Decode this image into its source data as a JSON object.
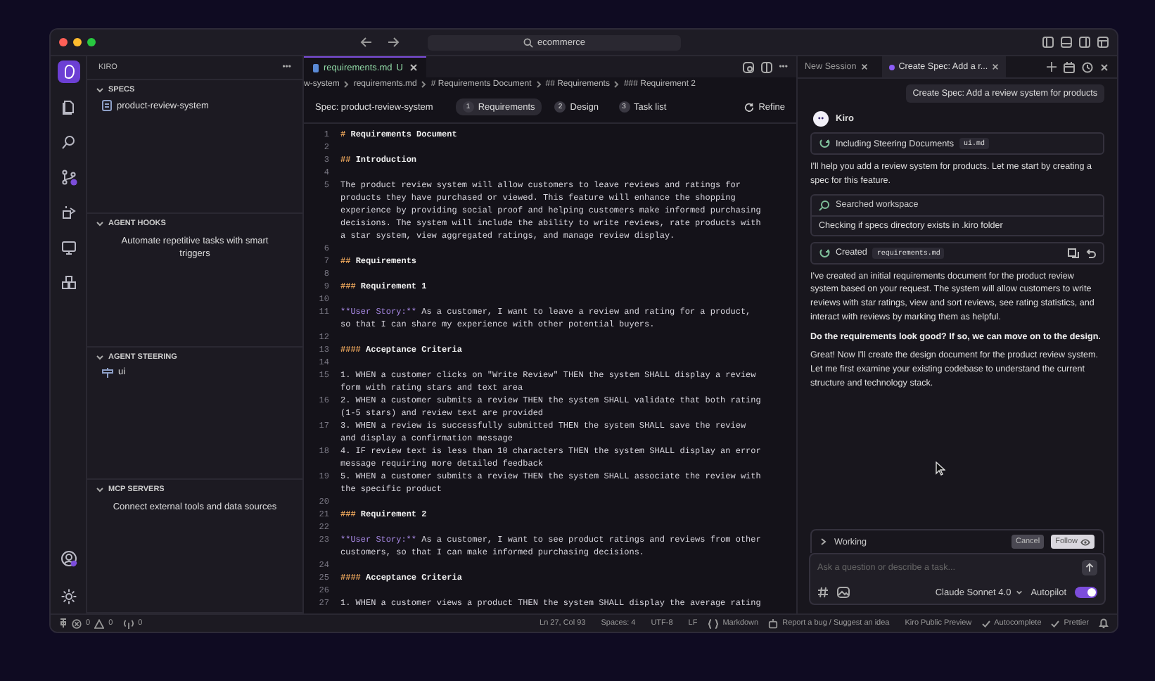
{
  "title_bar": {
    "search": "ecommerce"
  },
  "activity_bar": [
    {
      "selected": true
    },
    {
      "selected": false
    },
    {
      "selected": false
    },
    {
      "selected": false
    },
    {
      "selected": false
    },
    {
      "selected": false
    },
    {
      "selected": false
    }
  ],
  "sidebar": {
    "title": "KIRO",
    "more": "•••",
    "sections": [
      {
        "title": "SPECS",
        "expanded": true,
        "items": [
          "product-review-system"
        ]
      },
      {
        "title": "AGENT HOOKS",
        "expanded": true,
        "message": "Automate repetitive tasks with smart triggers"
      },
      {
        "title": "AGENT STEERING",
        "expanded": true,
        "items": [
          "ui"
        ]
      },
      {
        "title": "MCP SERVERS",
        "expanded": true,
        "message": "Connect external tools and data sources"
      }
    ]
  },
  "editor": {
    "more": "•••",
    "tabs": [
      {
        "label": "requirements.md",
        "status": "U",
        "selected": true
      }
    ],
    "breadcrumb": [
      "w-system",
      "requirements.md",
      "# Requirements Document",
      "## Requirements",
      "### Requirement 2"
    ],
    "spec": {
      "label": "Spec: product-review-system",
      "steps": [
        {
          "number": "1",
          "label": "Requirements",
          "selected": true
        },
        {
          "number": "2",
          "label": "Design",
          "selected": false
        },
        {
          "number": "3",
          "label": "Task list",
          "selected": false
        }
      ],
      "refine": "Refine"
    },
    "lines": [
      {
        "n": "1",
        "kind": "heading",
        "marker": "#",
        "rows": [
          "Requirements Document"
        ]
      },
      {
        "n": "2",
        "kind": "blank"
      },
      {
        "n": "3",
        "kind": "heading",
        "marker": "##",
        "rows": [
          "Introduction"
        ]
      },
      {
        "n": "4",
        "kind": "blank"
      },
      {
        "n": "5",
        "kind": "text",
        "rows": [
          "The product review system will allow customers to leave reviews and ratings for",
          "products they have purchased or viewed. This feature will enhance the shopping",
          "experience by providing social proof and helping customers make informed purchasing",
          "decisions. The system will include the ability to write reviews, rate products with",
          "a star system, view aggregated ratings, and manage review display."
        ]
      },
      {
        "n": "6",
        "kind": "blank"
      },
      {
        "n": "7",
        "kind": "heading",
        "marker": "##",
        "rows": [
          "Requirements"
        ]
      },
      {
        "n": "8",
        "kind": "blank"
      },
      {
        "n": "9",
        "kind": "heading",
        "marker": "###",
        "rows": [
          "Requirement 1"
        ]
      },
      {
        "n": "10",
        "kind": "blank"
      },
      {
        "n": "11",
        "kind": "story",
        "marker": "**User Story:**",
        "rows": [
          "As a customer, I want to leave a review and rating for a product,",
          "so that I can share my experience with other potential buyers."
        ]
      },
      {
        "n": "12",
        "kind": "blank"
      },
      {
        "n": "13",
        "kind": "heading",
        "marker": "####",
        "rows": [
          "Acceptance Criteria"
        ]
      },
      {
        "n": "14",
        "kind": "blank"
      },
      {
        "n": "15",
        "kind": "text",
        "rows": [
          "1. WHEN a customer clicks on \"Write Review\" THEN the system SHALL display a review",
          "form with rating stars and text area"
        ]
      },
      {
        "n": "16",
        "kind": "text",
        "rows": [
          "2. WHEN a customer submits a review THEN the system SHALL validate that both rating",
          "(1-5 stars) and review text are provided"
        ]
      },
      {
        "n": "17",
        "kind": "text",
        "rows": [
          "3. WHEN a review is successfully submitted THEN the system SHALL save the review",
          "and display a confirmation message"
        ]
      },
      {
        "n": "18",
        "kind": "text",
        "rows": [
          "4. IF review text is less than 10 characters THEN the system SHALL display an error",
          "message requiring more detailed feedback"
        ]
      },
      {
        "n": "19",
        "kind": "text",
        "rows": [
          "5. WHEN a customer submits a review THEN the system SHALL associate the review with",
          "the specific product"
        ]
      },
      {
        "n": "20",
        "kind": "blank"
      },
      {
        "n": "21",
        "kind": "heading",
        "marker": "###",
        "rows": [
          "Requirement 2"
        ]
      },
      {
        "n": "22",
        "kind": "blank"
      },
      {
        "n": "23",
        "kind": "story",
        "marker": "**User Story:**",
        "rows": [
          "As a customer, I want to see product ratings and reviews from other",
          "customers, so that I can make informed purchasing decisions."
        ]
      },
      {
        "n": "24",
        "kind": "blank"
      },
      {
        "n": "25",
        "kind": "heading",
        "marker": "####",
        "rows": [
          "Acceptance Criteria"
        ]
      },
      {
        "n": "26",
        "kind": "blank"
      },
      {
        "n": "27",
        "kind": "text",
        "rows": [
          "1. WHEN a customer views a product THEN the system SHALL display the average rating"
        ]
      }
    ]
  },
  "chat": {
    "tabs": [
      {
        "label": "New Session",
        "selected": false
      },
      {
        "label": "Create Spec: Add a r...",
        "selected": true
      }
    ],
    "user_message": "Create Spec: Add a review system for products",
    "agent": "Kiro",
    "items": [
      {
        "kind": "tool",
        "label": "Including Steering Documents",
        "chip": "ui.md"
      },
      {
        "kind": "text",
        "text": "I'll help you add a review system for products. Let me start by creating a spec for this feature."
      },
      {
        "kind": "search",
        "label": "Searched workspace",
        "detail": "Checking if specs directory exists in .kiro folder"
      },
      {
        "kind": "created",
        "label": "Created",
        "chip": "requirements.md"
      },
      {
        "kind": "text",
        "text": "I've created an initial requirements document for the product review system based on your request. The system will allow customers to write reviews with star ratings, view and sort reviews, see rating statistics, and interact with reviews by marking them as helpful."
      },
      {
        "kind": "bold",
        "text": "Do the requirements look good? If so, we can move on to the design."
      },
      {
        "kind": "text",
        "text": "Great! Now I'll create the design document for the product review system. Let me first examine your existing codebase to understand the current structure and technology stack."
      }
    ],
    "working": {
      "label": "Working",
      "cancel": "Cancel",
      "follow": "Follow"
    },
    "input": {
      "placeholder": "Ask a question or describe a task...",
      "model": "Claude Sonnet 4.0",
      "autopilot": {
        "label": "Autopilot",
        "on": true
      }
    }
  },
  "status_bar": {
    "errors": "0",
    "warnings": "0",
    "ports": "0",
    "right": [
      "Ln 27, Col 93",
      "Spaces: 4",
      "UTF-8",
      "LF"
    ],
    "language": "Markdown",
    "feedback": "Report a bug / Suggest an idea",
    "preview": "Kiro Public Preview",
    "checks": [
      "Autocomplete",
      "Prettier"
    ]
  }
}
